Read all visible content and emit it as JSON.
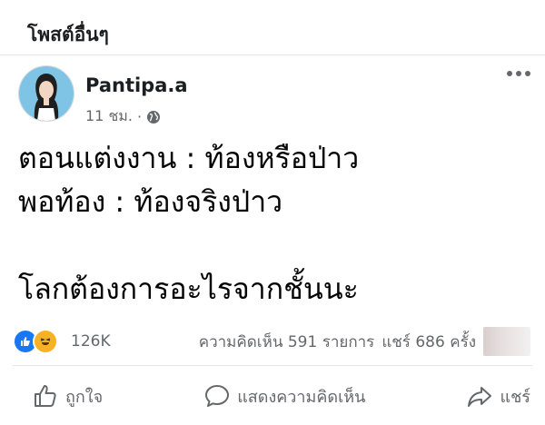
{
  "section": {
    "title": "โพสต์อื่นๆ"
  },
  "post": {
    "author": "Pantipa.a",
    "time": "11 ชม.",
    "separator": "·",
    "lines": [
      "ตอนแต่งงาน : ท้องหรือป่าว",
      "พอท้อง : ท้องจริงป่าว",
      "",
      "โลกต้องการอะไรจากชั้นนะ"
    ]
  },
  "stats": {
    "reactions_count": "126K",
    "comments": "ความคิดเห็น 591 รายการ",
    "shares": "แชร์ 686 ครั้ง"
  },
  "actions": {
    "like": "ถูกใจ",
    "comment": "แสดงความคิดเห็น",
    "share": "แชร์"
  },
  "colors": {
    "like_blue": "#1877f2",
    "haha_yellow": "#f7b125",
    "secondary_text": "#65676b"
  },
  "icons": {
    "reactions": [
      "like-icon",
      "haha-icon"
    ],
    "privacy": "globe-icon",
    "menu": "more-icon"
  }
}
